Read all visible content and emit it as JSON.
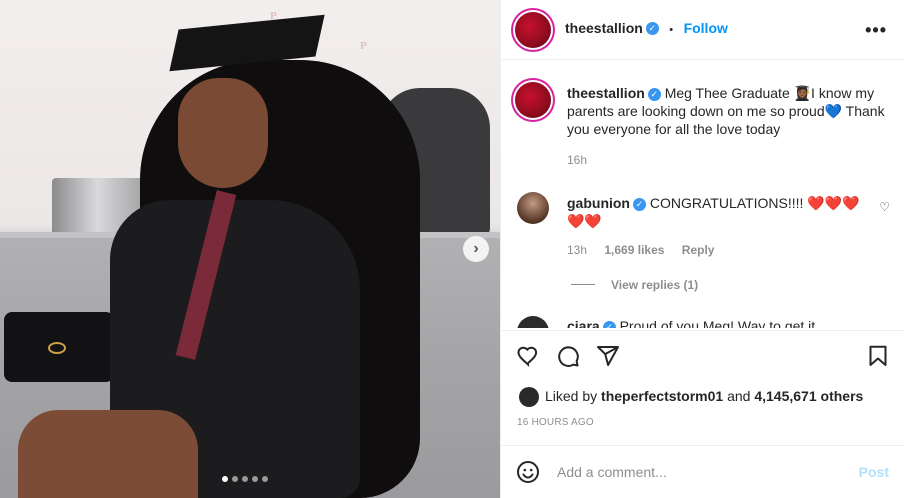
{
  "post": {
    "photo_alt_icon": "graduation-photo",
    "carousel_dots": 5,
    "active_dot": 0
  },
  "header": {
    "username": "theestallion",
    "dot": "•",
    "follow_label": "Follow",
    "more_icon": "more-horizontal-icon",
    "more_text": "•••"
  },
  "caption": {
    "username": "theestallion",
    "text_1": "Meg Thee Graduate 👩🏾‍🎓I know my parents are looking down on me so proud💙 Thank you everyone for all the love today",
    "time": "16h"
  },
  "comments": [
    {
      "username": "gabunion",
      "text": "CONGRATULATIONS!!!! ❤️❤️❤️❤️❤️",
      "time": "13h",
      "likes": "1,669 likes",
      "reply": "Reply",
      "view_replies": "View replies (1)"
    },
    {
      "username": "ciara",
      "text": "Proud of you Meg! Way to get it"
    }
  ],
  "likes": {
    "prefix": "Liked by",
    "user": "theperfectstorm01",
    "and": "and",
    "others": "4,145,671 others",
    "timestamp": "16 HOURS AGO"
  },
  "add_comment": {
    "placeholder": "Add a comment...",
    "post_label": "Post"
  },
  "colors": {
    "accent": "#0095f6",
    "post_disabled": "#b2dffc",
    "text": "#262626",
    "muted": "#8e8e8e"
  }
}
